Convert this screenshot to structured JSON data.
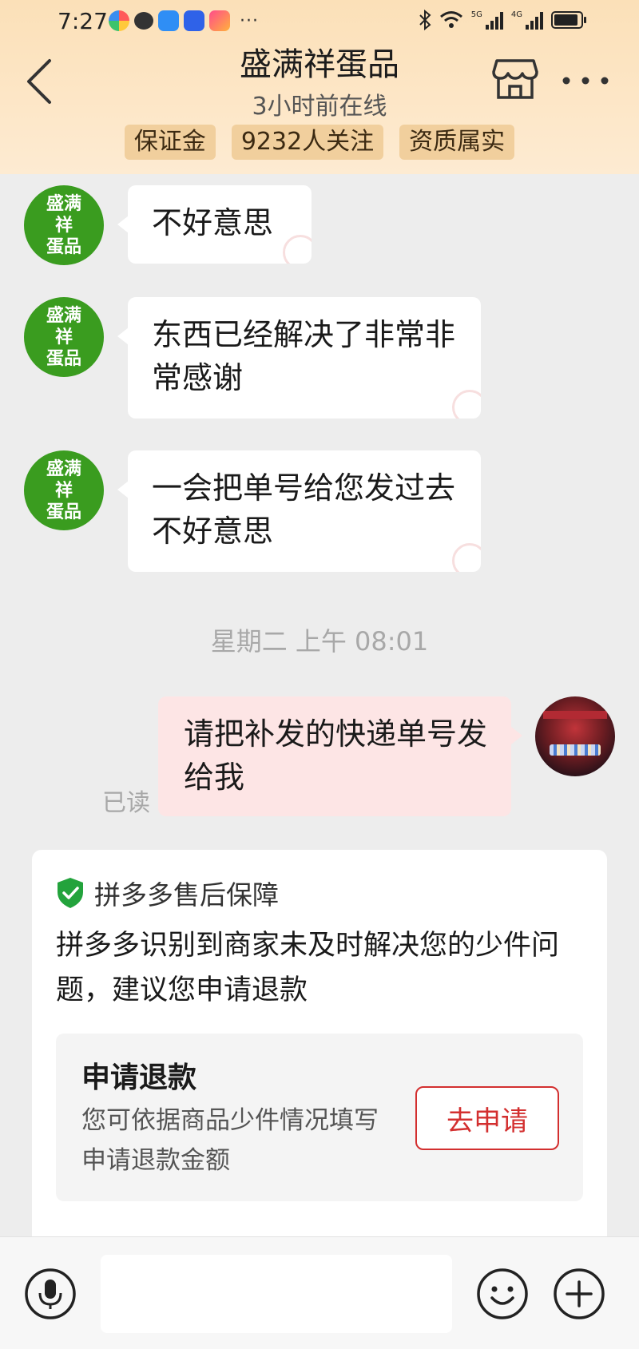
{
  "status_bar": {
    "time": "7:27",
    "more": "···",
    "net_1": "5G",
    "net_2": "4G"
  },
  "header": {
    "shop_name": "盛满祥蛋品",
    "online_status": "3小时前在线",
    "badges": [
      "保证金",
      "9232人关注",
      "资质属实"
    ]
  },
  "merchant": {
    "avatar_line1": "盛满祥",
    "avatar_line2": "蛋品"
  },
  "messages": [
    {
      "from": "merchant",
      "text": "不好意思"
    },
    {
      "from": "merchant",
      "text": "东西已经解决了非常非常感谢"
    },
    {
      "from": "merchant",
      "text": "一会把单号给您发过去不好意思"
    },
    {
      "from": "me",
      "text": "请把补发的快递单号发给我",
      "status": "已读"
    }
  ],
  "timestamp": "星期二 上午 08:01",
  "after_sale_card": {
    "title": "拼多多售后保障",
    "body": "拼多多识别到商家未及时解决您的少件问题，建议您申请退款",
    "refund": {
      "title": "申请退款",
      "description": "您可依据商品少件情况填写申请退款金额",
      "button": "去申请"
    }
  },
  "input_bar": {
    "placeholder": ""
  },
  "colors": {
    "header_bg": "#fde6c6",
    "badge_bg": "#f1cf9d",
    "merchant_avatar": "#3a9c1f",
    "my_bubble": "#fde5e5",
    "refund_button": "#d32f2f",
    "shield": "#23a33c"
  },
  "icons": [
    "back-arrow-icon",
    "store-icon",
    "more-dots-icon",
    "shield-check-icon",
    "voice-icon",
    "emoji-icon",
    "plus-icon"
  ]
}
